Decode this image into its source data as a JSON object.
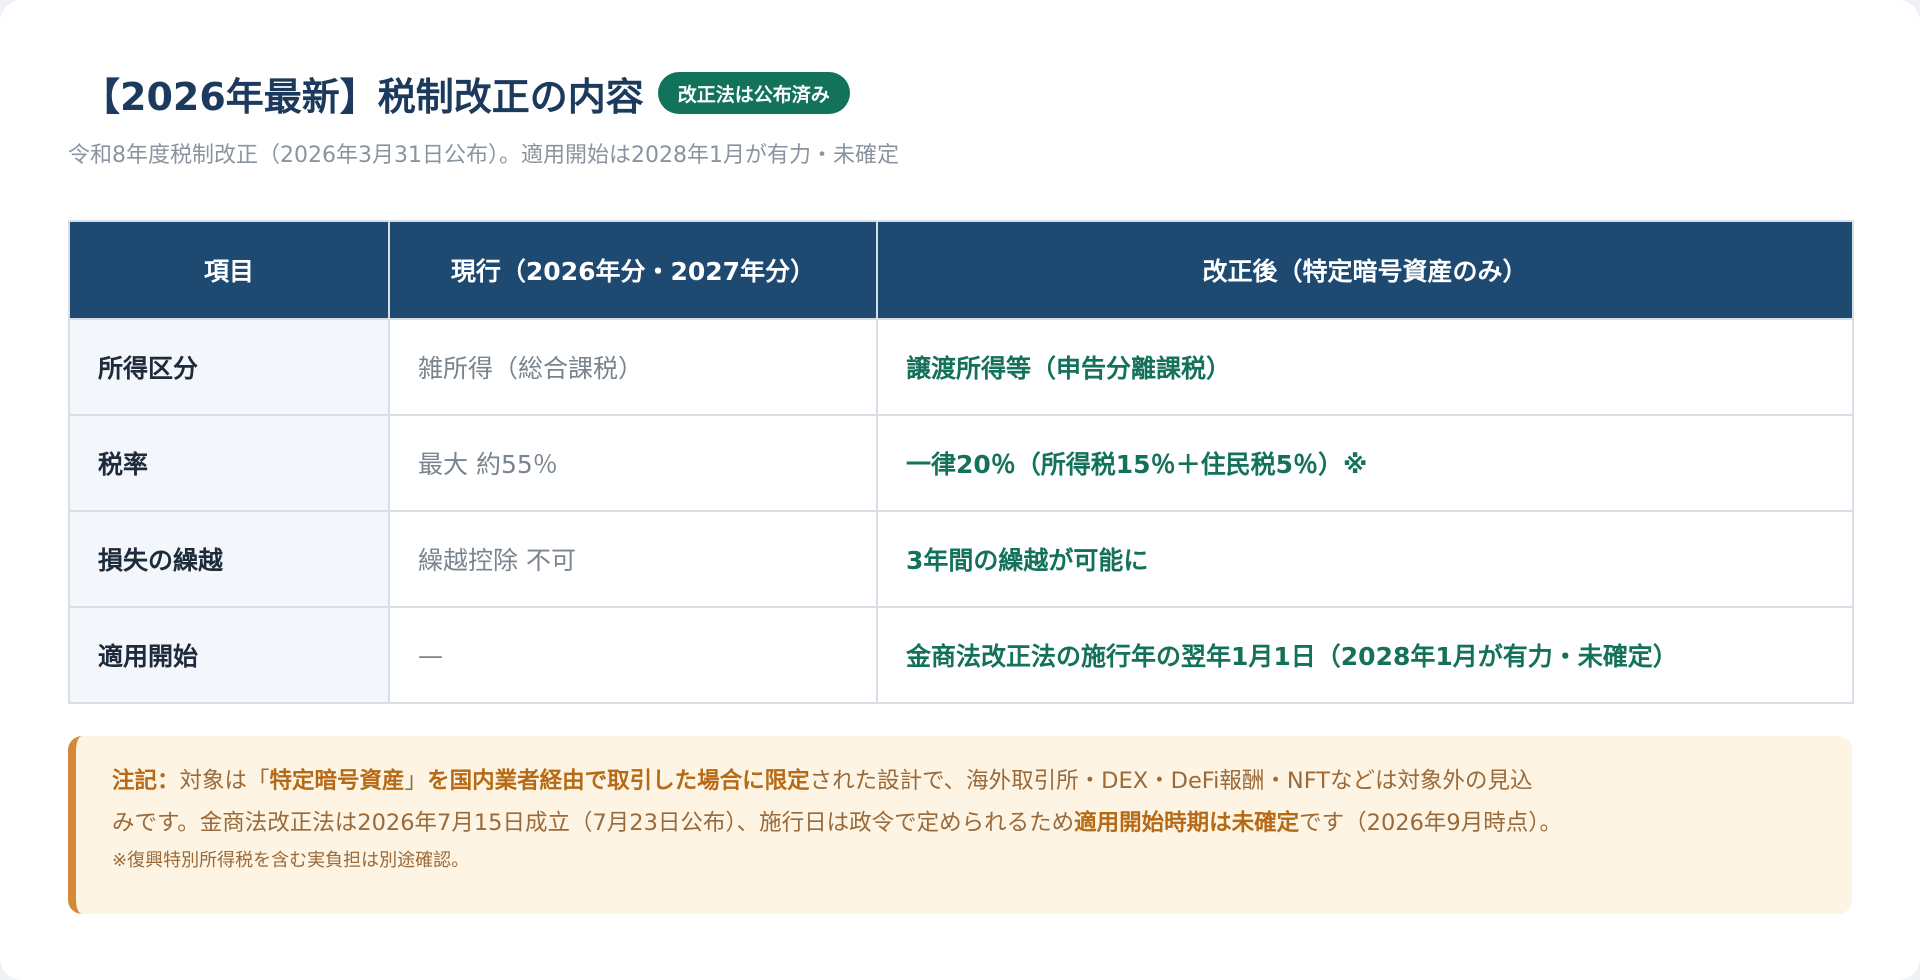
{
  "header": {
    "title": "【2026年最新】税制改正の内容",
    "badge": "改正法は公布済み",
    "subtitle": "令和8年度税制改正（2026年3月31日公布）。適用開始は2028年1月が有力・未確定"
  },
  "table": {
    "columns": [
      "項目",
      "現行（2026年分・2027年分）",
      "改正後（特定暗号資産のみ）"
    ],
    "rows": [
      {
        "item": "所得区分",
        "current": "雑所得（総合課税）",
        "revised": "譲渡所得等（申告分離課税）"
      },
      {
        "item": "税率",
        "current": "最大 約55％",
        "revised": "一律20％（所得税15％＋住民税5％）※"
      },
      {
        "item": "損失の繰越",
        "current": "繰越控除 不可",
        "revised": "3年間の繰越が可能に"
      },
      {
        "item": "適用開始",
        "current": "—",
        "revised": "金商法改正法の施行年の翌年1月1日（2028年1月が有力・未確定）"
      }
    ]
  },
  "note": {
    "label": "注記：",
    "part1": "対象は「",
    "emph1": "特定暗号資産",
    "part2": "」",
    "emph2": "を国内業者経由で取引した場合に限定",
    "part3": "された設計で、海外取引所・DEX・DeFi報酬・NFTなどは対象外の見込",
    "line2_part1": "みです。金商法改正法は2026年7月15日成立（7月23日公布）、施行日は政令で定められるため",
    "line2_emph": "適用開始時期は未確定",
    "line2_part2": "です（2026年9月時点）。",
    "small": "※復興特別所得税を含む実負担は別途確認。"
  },
  "colors": {
    "header_bg": "#1e4a72",
    "badge_bg": "#13725a",
    "revised_text": "#14715a",
    "note_accent": "#d4883a",
    "note_bg": "#fdf4e3"
  }
}
